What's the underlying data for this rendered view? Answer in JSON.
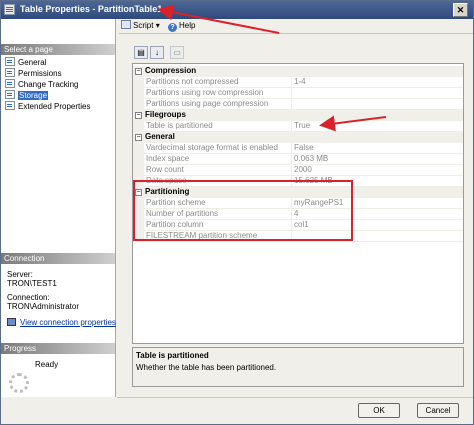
{
  "window": {
    "title": "Table Properties - PartitionTable1",
    "close_label": "✕"
  },
  "left_pane": {
    "select_page_header": "Select a page",
    "pages": [
      {
        "label": "General",
        "selected": false
      },
      {
        "label": "Permissions",
        "selected": false
      },
      {
        "label": "Change Tracking",
        "selected": false
      },
      {
        "label": "Storage",
        "selected": true
      },
      {
        "label": "Extended Properties",
        "selected": false
      }
    ],
    "connection_header": "Connection",
    "server_label": "Server:",
    "server_value": "TRON\\TEST1",
    "connection_label": "Connection:",
    "connection_value": "TRON\\Administrator",
    "view_connection_link": "View connection properties",
    "progress_header": "Progress",
    "progress_status": "Ready"
  },
  "toolbar": {
    "script_label": "Script",
    "script_dropdown": "▾",
    "help_label": "Help"
  },
  "property_grid": {
    "categories": [
      {
        "name": "Compression",
        "properties": [
          {
            "name": "Partitions not compressed",
            "value": "1-4"
          },
          {
            "name": "Partitions using row compression",
            "value": ""
          },
          {
            "name": "Partitions using page compression",
            "value": ""
          }
        ]
      },
      {
        "name": "Filegroups",
        "properties": [
          {
            "name": "Table is partitioned",
            "value": "True"
          }
        ]
      },
      {
        "name": "General",
        "properties": [
          {
            "name": "Vardecimal storage format is enabled",
            "value": "False"
          },
          {
            "name": "Index space",
            "value": "0.063 MB"
          },
          {
            "name": "Row count",
            "value": "2000"
          },
          {
            "name": "Data space",
            "value": "15.625 MB"
          }
        ]
      },
      {
        "name": "Partitioning",
        "properties": [
          {
            "name": "Partition scheme",
            "value": "myRangePS1"
          },
          {
            "name": "Number of partitions",
            "value": "4"
          },
          {
            "name": "Partition column",
            "value": "col1"
          },
          {
            "name": "FILESTREAM partition scheme",
            "value": ""
          }
        ]
      }
    ]
  },
  "description": {
    "title": "Table is partitioned",
    "text": "Whether the table has been partitioned."
  },
  "buttons": {
    "ok_label": "OK",
    "cancel_label": "Cancel"
  },
  "annotations": {
    "color": "#d9222a"
  }
}
